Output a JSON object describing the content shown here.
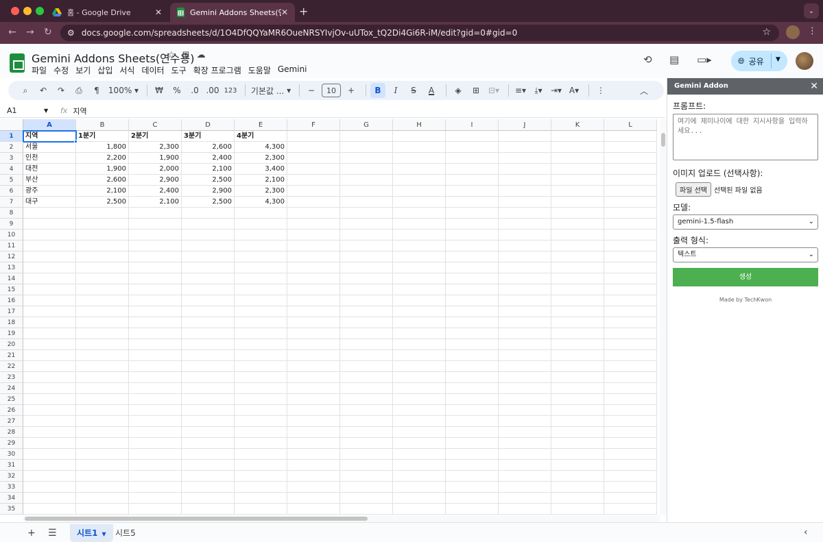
{
  "browser": {
    "tabs": [
      {
        "title": "홈 - Google Drive",
        "icon": "google-drive-icon"
      },
      {
        "title": "Gemini Addons Sheets(연수용)",
        "icon": "google-sheets-icon"
      }
    ],
    "url": "docs.google.com/spreadsheets/d/1O4DfQQYaMR6OueNRSYIvjOv-uUTox_tQ2Di4Gi6R-iM/edit?gid=0#gid=0"
  },
  "sheets": {
    "title": "Gemini Addons Sheets(연수용)",
    "menu": [
      "파일",
      "수정",
      "보기",
      "삽입",
      "서식",
      "데이터",
      "도구",
      "확장 프로그램",
      "도움말",
      "Gemini"
    ],
    "share_label": "공유",
    "toolbar": {
      "zoom": "100%",
      "currency": "₩",
      "percent": "%",
      "dec_decrease": ".0",
      "dec_increase": ".00",
      "number_format": "123",
      "font": "기본값 ...",
      "font_size": "10"
    },
    "name_box": "A1",
    "formula": "지역",
    "columns": [
      "A",
      "B",
      "C",
      "D",
      "E",
      "F",
      "G",
      "H",
      "I",
      "J",
      "K",
      "L"
    ],
    "row_count": 35,
    "data": [
      [
        "지역",
        "1분기",
        "2분기",
        "3분기",
        "4분기"
      ],
      [
        "서울",
        "1,800",
        "2,300",
        "2,600",
        "4,300"
      ],
      [
        "인천",
        "2,200",
        "1,900",
        "2,400",
        "2,300"
      ],
      [
        "대전",
        "1,900",
        "2,000",
        "2,100",
        "3,400"
      ],
      [
        "부산",
        "2,600",
        "2,900",
        "2,500",
        "2,100"
      ],
      [
        "광주",
        "2,100",
        "2,400",
        "2,900",
        "2,300"
      ],
      [
        "대구",
        "2,500",
        "2,100",
        "2,500",
        "4,300"
      ]
    ],
    "sheet_tabs": [
      "시트1",
      "시트5"
    ],
    "active_sheet": "시트1"
  },
  "addon": {
    "title": "Gemini Addon",
    "prompt_label": "프롬프트:",
    "prompt_placeholder": "여기에 제미나이에 대한 지시사항을 입력하세요...",
    "image_label": "이미지 업로드 (선택사항):",
    "file_button": "파일 선택",
    "file_status": "선택된 파일 없음",
    "model_label": "모델:",
    "model_value": "gemini-1.5-flash",
    "format_label": "출력 형식:",
    "format_value": "텍스트",
    "generate_label": "생성",
    "credit": "Made by TechKwon"
  }
}
